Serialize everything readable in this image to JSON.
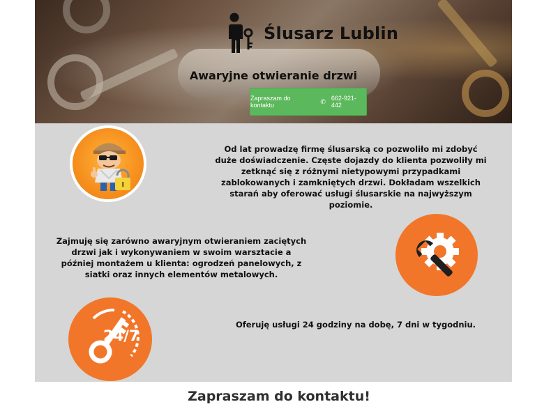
{
  "header": {
    "brand_title": "Ślusarz Lublin",
    "brand_icon": "locksmith-person-key-icon",
    "tagline": "Awaryjne otwieranie drzwi",
    "cta_label": "Zapraszam do kontaktu",
    "cta_phone_icon": "phone-icon",
    "cta_phone": "662-921-442"
  },
  "sections": [
    {
      "icon": "locksmith-mascot-icon",
      "text": "Od lat prowadzę firmę ślusarską co pozwoliło mi zdobyć duże doświadczenie. Częste dojazdy do klienta pozwoliły mi zetknąć się z różnymi nietypowymi przypadkami zablokowanych i zamkniętych drzwi. Dokładam wszelkich starań aby oferować usługi ślusarskie na najwyższym poziomie."
    },
    {
      "icon": "wrench-gear-icon",
      "text": "Zajmuję się zarówno awaryjnym otwieraniem zaciętych drzwi jak i wykonywaniem w swoim warsztacie a później montażem u klienta: ogrodzeń panelowych, z siatki oraz innych elementów metalowych."
    },
    {
      "icon": "key-24-7-icon",
      "badge": "24/7",
      "text": "Oferuję usługi 24 godziny na dobę, 7 dni w tygodniu."
    }
  ],
  "contact_heading": "Zapraszam do kontaktu!",
  "colors": {
    "accent_orange": "#f2762a",
    "cta_green": "#5cb85c",
    "content_bg": "#d6d6d6"
  }
}
